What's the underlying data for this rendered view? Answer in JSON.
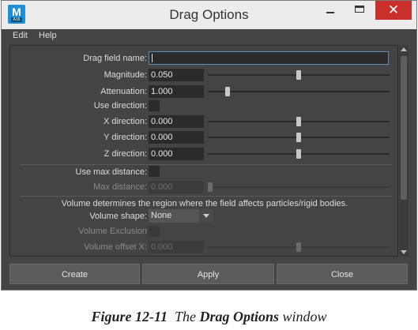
{
  "window": {
    "title": "Drag Options",
    "icon": {
      "name": "maya-app-icon",
      "letter": "M",
      "sub": "A16"
    },
    "buttons": {
      "minimize": "minimize-icon",
      "maximize": "maximize-icon",
      "close": "✕"
    },
    "accent_close": "#c9302c"
  },
  "menu": [
    "Edit",
    "Help"
  ],
  "fields": {
    "drag_field_name": {
      "label": "Drag field name:",
      "value": ""
    },
    "magnitude": {
      "label": "Magnitude:",
      "value": "0.050",
      "slider": 0.5
    },
    "attenuation": {
      "label": "Attenuation:",
      "value": "1.000",
      "slider": 0.1
    },
    "use_direction": {
      "label": "Use direction:"
    },
    "x_direction": {
      "label": "X direction:",
      "value": "0.000",
      "slider": 0.5
    },
    "y_direction": {
      "label": "Y direction:",
      "value": "0.000",
      "slider": 0.5
    },
    "z_direction": {
      "label": "Z direction:",
      "value": "0.000",
      "slider": 0.5
    },
    "use_max_distance": {
      "label": "Use max distance:"
    },
    "max_distance": {
      "label": "Max distance:",
      "value": "0.000",
      "slider": 0.0
    },
    "volume_note": "Volume determines the region where the field affects particles/rigid bodies.",
    "volume_shape": {
      "label": "Volume shape:",
      "value": "None"
    },
    "volume_exclusion": {
      "label": "Volume Exclusion"
    },
    "volume_offset_x": {
      "label": "Volume offset X:",
      "value": "0.000",
      "slider": 0.5
    }
  },
  "actions": {
    "create": "Create",
    "apply": "Apply",
    "close": "Close"
  },
  "caption": {
    "number": "Figure 12-11",
    "text_pre": "The",
    "window_name": "Drag Options",
    "text_post": "window"
  }
}
